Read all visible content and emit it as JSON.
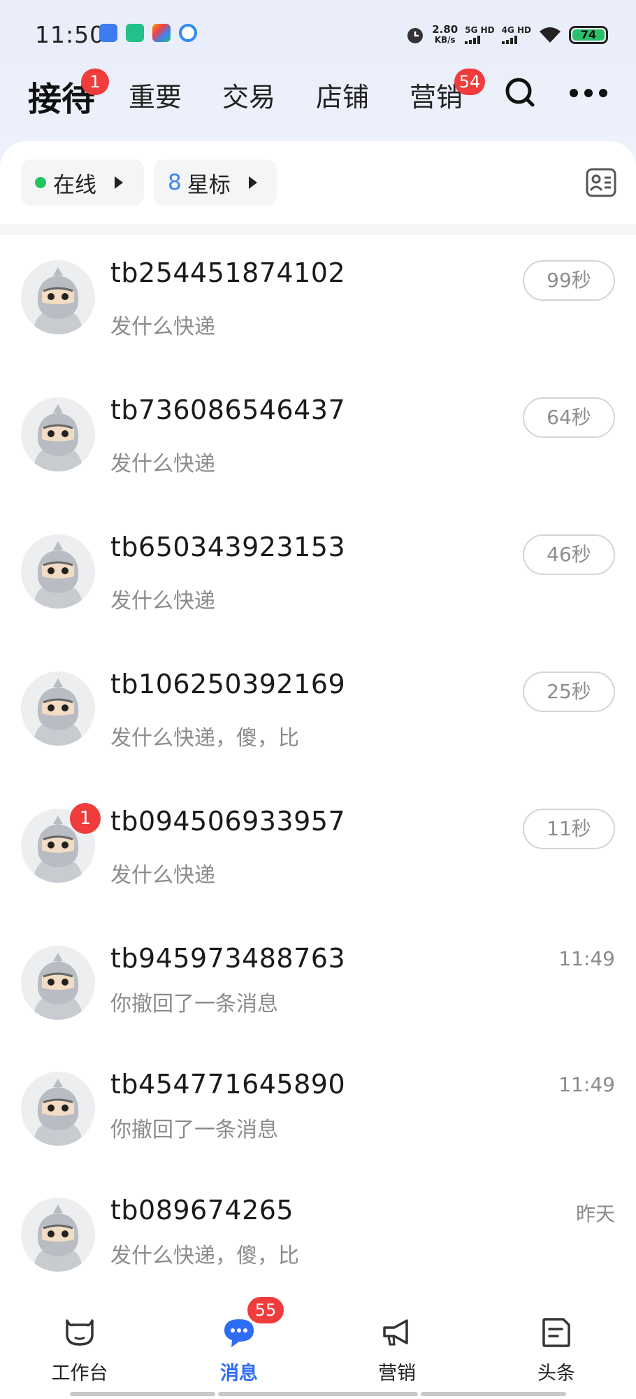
{
  "status_bar": {
    "time": "11:50",
    "speed_value": "2.80",
    "speed_unit": "KB/s",
    "net1": "5G HD",
    "net2": "4G HD",
    "battery": "74",
    "app_icons": [
      "app-icon-1",
      "app-icon-2",
      "app-icon-3",
      "app-icon-4"
    ]
  },
  "tabs": [
    {
      "label": "接待",
      "badge": "1"
    },
    {
      "label": "重要"
    },
    {
      "label": "交易"
    },
    {
      "label": "店铺"
    },
    {
      "label": "营销",
      "badge": "54"
    }
  ],
  "filters": {
    "online_label": "在线",
    "star_count": "8",
    "star_label": "星标"
  },
  "conversations": [
    {
      "name": "tb254451874102",
      "message": "发什么快递",
      "time": "99秒",
      "time_style": "pill"
    },
    {
      "name": "tb736086546437",
      "message": "发什么快递",
      "time": "64秒",
      "time_style": "pill"
    },
    {
      "name": "tb650343923153",
      "message": "发什么快递",
      "time": "46秒",
      "time_style": "pill"
    },
    {
      "name": "tb106250392169",
      "message": "发什么快递，傻，比",
      "time": "25秒",
      "time_style": "pill"
    },
    {
      "name": "tb094506933957",
      "message": "发什么快递",
      "time": "11秒",
      "time_style": "pill",
      "unread": "1"
    },
    {
      "name": "tb945973488763",
      "message": "你撤回了一条消息",
      "time": "11:49",
      "time_style": "text"
    },
    {
      "name": "tb454771645890",
      "message": "你撤回了一条消息",
      "time": "11:49",
      "time_style": "text"
    },
    {
      "name": "tb089674265",
      "message": "发什么快递，傻，比",
      "time": "昨天",
      "time_style": "text"
    }
  ],
  "bottom_nav": [
    {
      "label": "工作台",
      "icon": "cow-icon"
    },
    {
      "label": "消息",
      "icon": "chat-bubble-icon",
      "badge": "55",
      "active": true
    },
    {
      "label": "营销",
      "icon": "megaphone-icon"
    },
    {
      "label": "头条",
      "icon": "document-icon"
    }
  ],
  "colors": {
    "accent": "#2f6cf5",
    "badge": "#f03c3c",
    "online": "#22c55e",
    "battery": "#2cbf6a"
  }
}
